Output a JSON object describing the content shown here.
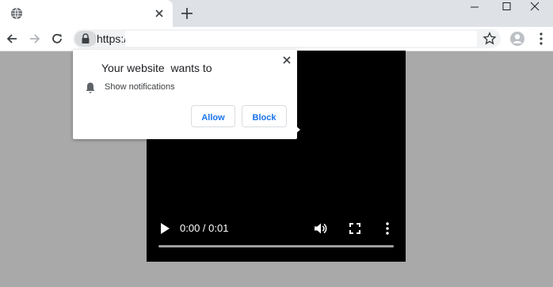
{
  "browser": {
    "tab_icon": "globe-icon",
    "omnibox": {
      "url_text": "https://"
    }
  },
  "video_player": {
    "time_display": "0:00 / 0:01",
    "progress_fraction": 0.0
  },
  "permission_popup": {
    "site_name": "Your website",
    "request_text": "wants to",
    "permission_label": "Show notifications",
    "allow_label": "Allow",
    "block_label": "Block"
  },
  "colors": {
    "accent": "#1a73e8",
    "page_background": "#a9a9a9",
    "tabbar_background": "#dee1e6"
  }
}
